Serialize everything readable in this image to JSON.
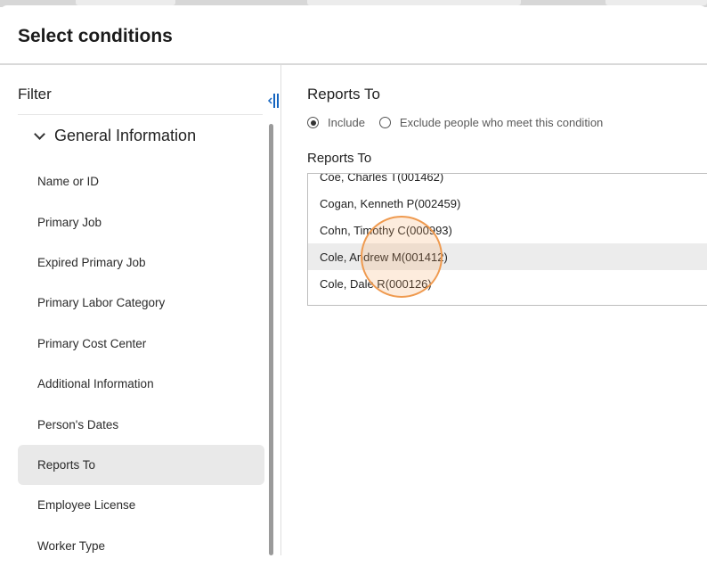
{
  "dialog": {
    "title": "Select conditions"
  },
  "filter": {
    "label": "Filter",
    "group_label": "General Information",
    "items": [
      {
        "label": "Name or ID",
        "selected": false
      },
      {
        "label": "Primary Job",
        "selected": false
      },
      {
        "label": "Expired Primary Job",
        "selected": false
      },
      {
        "label": "Primary Labor Category",
        "selected": false
      },
      {
        "label": "Primary Cost Center",
        "selected": false
      },
      {
        "label": "Additional Information",
        "selected": false
      },
      {
        "label": "Person's Dates",
        "selected": false
      },
      {
        "label": "Reports To",
        "selected": true
      },
      {
        "label": "Employee License",
        "selected": false
      },
      {
        "label": "Worker Type",
        "selected": false
      }
    ]
  },
  "condition": {
    "title": "Reports To",
    "include_label": "Include",
    "exclude_label": "Exclude people who meet this condition",
    "selected_option": "include",
    "field_label": "Reports To",
    "options": [
      "Coe, Charles T(001462)",
      "Cogan, Kenneth P(002459)",
      "Cohn, Timothy C(000993)",
      "Cole, Andrew M(001412)",
      "Cole, Dale R(000126)"
    ],
    "hovered_index": 3
  },
  "colors": {
    "accent_cursor": "#ef9a4f",
    "selected_bg": "#e9e9e9"
  }
}
